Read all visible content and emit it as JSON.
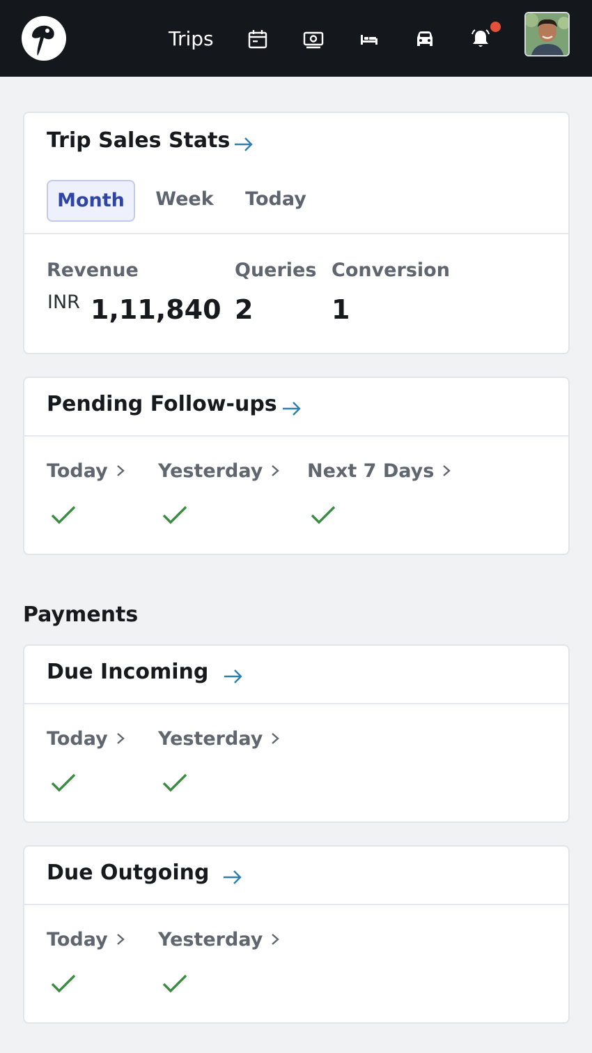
{
  "header": {
    "nav_label": "Trips",
    "notification_dot_color": "#e4503a",
    "icons": [
      "logo-icon",
      "calendar-icon",
      "money-icon",
      "bed-icon",
      "car-icon",
      "bell-icon"
    ]
  },
  "trip_sales": {
    "title": "Trip Sales Stats",
    "tabs": [
      {
        "label": "Month",
        "active": true
      },
      {
        "label": "Week",
        "active": false
      },
      {
        "label": "Today",
        "active": false
      }
    ],
    "revenue_label": "Revenue",
    "revenue_currency": "INR",
    "revenue_value": "1,11,840",
    "queries_label": "Queries",
    "queries_value": "2",
    "conversion_label": "Conversion",
    "conversion_value": "1"
  },
  "pending_followups": {
    "title": "Pending Follow-ups",
    "items": [
      {
        "label": "Today"
      },
      {
        "label": "Yesterday"
      },
      {
        "label": "Next 7 Days"
      }
    ]
  },
  "payments": {
    "section_title": "Payments",
    "due_incoming": {
      "title": "Due Incoming",
      "items": [
        {
          "label": "Today"
        },
        {
          "label": "Yesterday"
        }
      ]
    },
    "due_outgoing": {
      "title": "Due Outgoing",
      "items": [
        {
          "label": "Today"
        },
        {
          "label": "Yesterday"
        }
      ]
    }
  },
  "colors": {
    "accent_arrow": "#2b7fb0",
    "check_green": "#3f8a45",
    "active_tab_text": "#2f45a6",
    "header_bg": "#14181d"
  }
}
